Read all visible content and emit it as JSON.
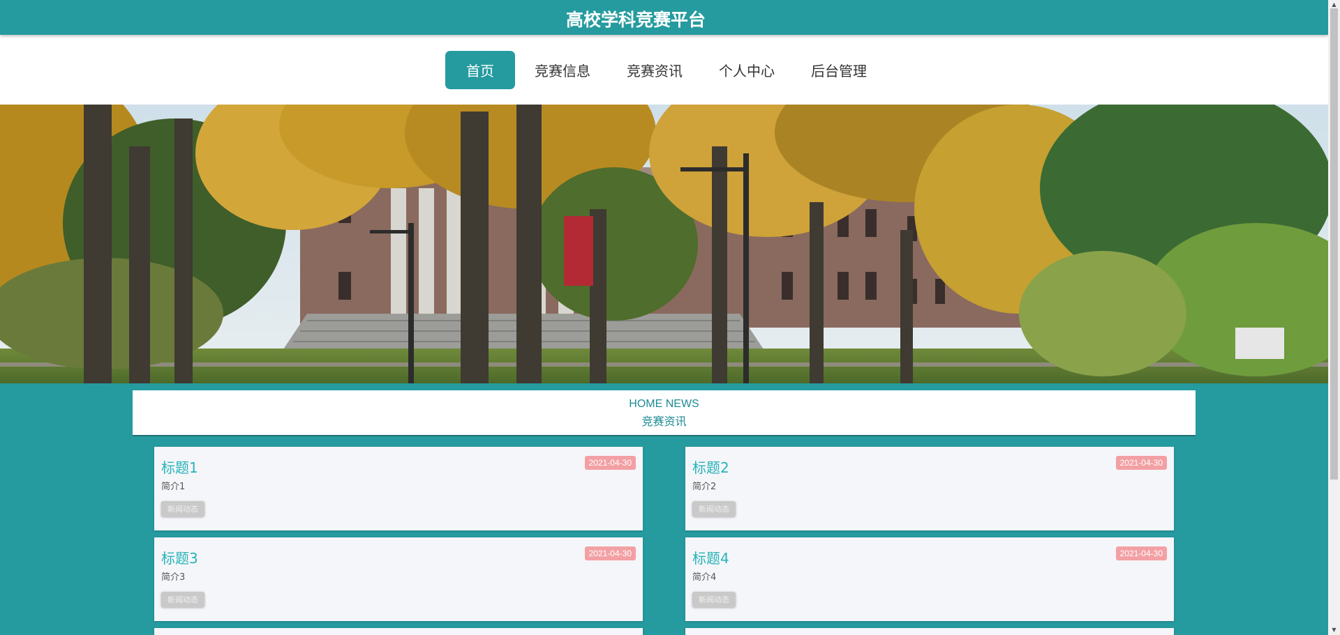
{
  "header": {
    "title": "高校学科竞赛平台"
  },
  "nav": {
    "items": [
      {
        "label": "首页",
        "active": true
      },
      {
        "label": "竞赛信息"
      },
      {
        "label": "竞赛资讯"
      },
      {
        "label": "个人中心"
      },
      {
        "label": "后台管理"
      }
    ]
  },
  "news": {
    "heading_en": "HOME NEWS",
    "heading_cn": "竞赛资讯",
    "items": [
      {
        "title": "标题1",
        "date": "2021-04-30",
        "summary": "简介1",
        "tag": "新闻动态"
      },
      {
        "title": "标题2",
        "date": "2021-04-30",
        "summary": "简介2",
        "tag": "新闻动态"
      },
      {
        "title": "标题3",
        "date": "2021-04-30",
        "summary": "简介3",
        "tag": "新闻动态"
      },
      {
        "title": "标题4",
        "date": "2021-04-30",
        "summary": "简介4",
        "tag": "新闻动态"
      }
    ]
  },
  "colors": {
    "brand": "#259b9f",
    "title_text": "#26b3b8",
    "date_badge": "#f3a0a4",
    "tag_badge": "#c9c9c9"
  },
  "icons": [
    "scroll-up-arrow-icon",
    "scroll-down-arrow-icon"
  ]
}
